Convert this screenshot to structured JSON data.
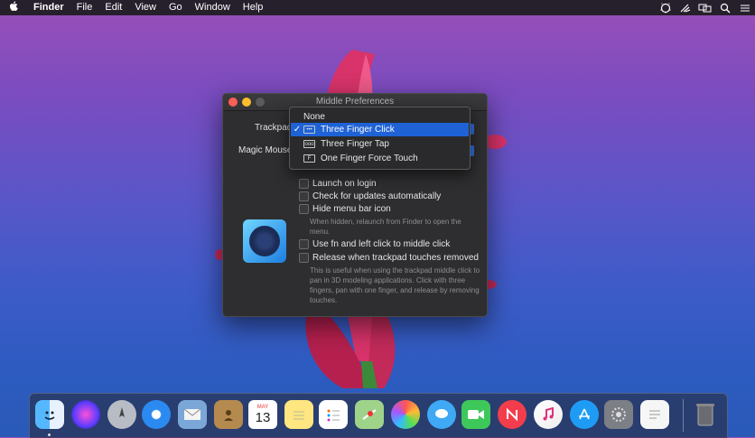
{
  "menubar": {
    "app_name": "Finder",
    "items": [
      "File",
      "Edit",
      "View",
      "Go",
      "Window",
      "Help"
    ],
    "status_icons": [
      "middle-app-icon",
      "wifi-like-icon",
      "display-mirror-icon",
      "search-icon",
      "menu-list-icon"
    ]
  },
  "window": {
    "title": "Middle Preferences",
    "trackpad_label": "Trackpad",
    "magic_mouse_label": "Magic Mouse",
    "options": {
      "launch_on_login": "Launch on login",
      "check_updates": "Check for updates automatically",
      "hide_menu_bar_icon": "Hide menu bar icon",
      "hide_note": "When hidden, relaunch from Finder to open the menu.",
      "fn_left_click": "Use fn and left click to middle click",
      "release_trackpad": "Release when trackpad touches removed",
      "release_note": "This is useful when using the trackpad middle click to pan in 3D modeling applications. Click with three fingers, pan with one finger, and release by removing touches."
    }
  },
  "dropdown": {
    "items": [
      {
        "label": "None",
        "checked": false,
        "selected": false,
        "icon": ""
      },
      {
        "label": "Three Finger Click",
        "checked": true,
        "selected": true,
        "icon": "three-dots-icon"
      },
      {
        "label": "Three Finger Tap",
        "checked": false,
        "selected": false,
        "icon": "three-circles-icon"
      },
      {
        "label": "One Finger Force Touch",
        "checked": false,
        "selected": false,
        "icon": "f-icon"
      }
    ],
    "check_glyph": "✓",
    "force_glyph": "F",
    "dots_glyph": "•••",
    "circles_glyph": "ooo"
  },
  "dock": {
    "apps": [
      "Finder",
      "Siri",
      "Launchpad",
      "Safari",
      "Mail",
      "Contacts",
      "Calendar",
      "Notes",
      "Reminders",
      "Maps",
      "Photos",
      "Messages",
      "FaceTime",
      "News",
      "iTunes",
      "App Store",
      "System Preferences",
      "TextEdit",
      "Trash"
    ],
    "calendar_month": "MAY",
    "calendar_day": "13"
  },
  "colors": {
    "accent": "#1e62d6",
    "close": "#fc5f57",
    "minimize": "#fdbc2e"
  }
}
